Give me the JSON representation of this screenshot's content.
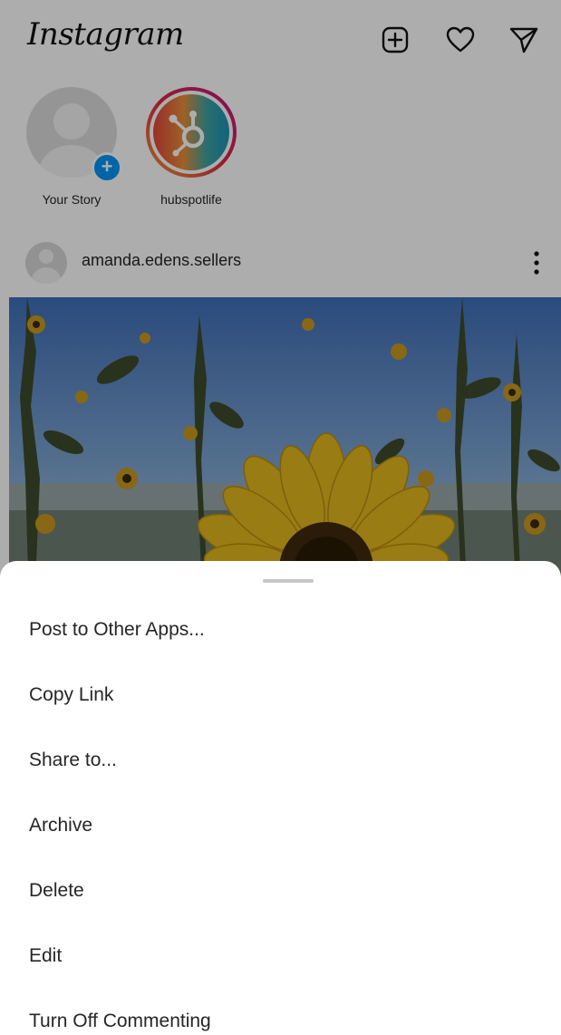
{
  "header": {
    "logo_text": "Instagram"
  },
  "icons": {
    "new_post": "plus-square-icon",
    "activity": "heart-icon",
    "direct": "paper-plane-icon"
  },
  "stories": [
    {
      "label": "Your Story"
    },
    {
      "label": "hubspotlife"
    }
  ],
  "post": {
    "username": "amanda.edens.sellers"
  },
  "sheet": {
    "items": [
      {
        "label": "Post to Other Apps..."
      },
      {
        "label": "Copy Link"
      },
      {
        "label": "Share to..."
      },
      {
        "label": "Archive"
      },
      {
        "label": "Delete"
      },
      {
        "label": "Edit"
      },
      {
        "label": "Turn Off Commenting"
      }
    ]
  },
  "colors": {
    "story_badge": "#0095f6",
    "text": "#262626",
    "sheet_background": "#ffffff"
  }
}
